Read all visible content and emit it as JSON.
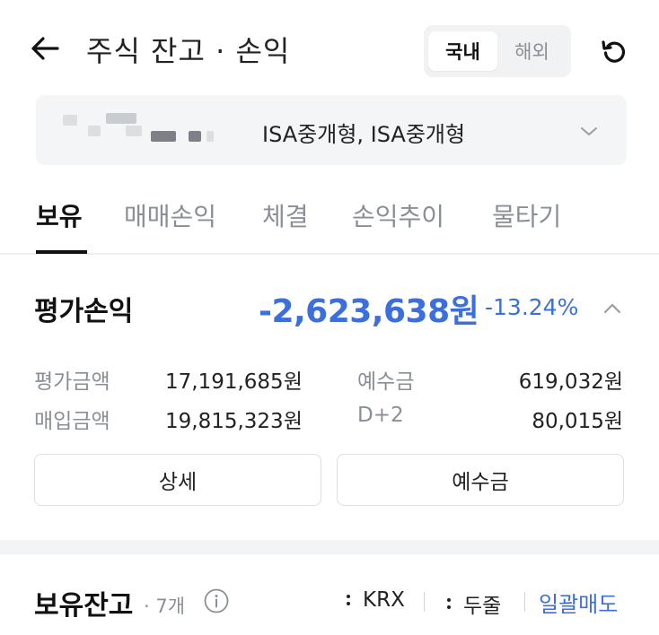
{
  "header": {
    "title": "주식 잔고 · 손익",
    "market_toggle": {
      "domestic": "국내",
      "overseas": "해외",
      "selected": "domestic"
    }
  },
  "account": {
    "name": "ISA중개형, ISA중개형"
  },
  "tabs": [
    {
      "label": "보유",
      "active": true
    },
    {
      "label": "매매손익",
      "active": false
    },
    {
      "label": "체결",
      "active": false
    },
    {
      "label": "손익추이",
      "active": false
    },
    {
      "label": "물타기",
      "active": false
    }
  ],
  "pnl": {
    "label": "평가손익",
    "value": "-2,623,638원",
    "rate": "-13.24%"
  },
  "summary": {
    "eval_amount": {
      "label": "평가금액",
      "value": "17,191,685원"
    },
    "purchase_amount": {
      "label": "매입금액",
      "value": "19,815,323원"
    },
    "deposit": {
      "label": "예수금",
      "value": "619,032원"
    },
    "d2": {
      "label": "D+2",
      "value": "80,015원"
    }
  },
  "buttons": {
    "detail": "상세",
    "deposit": "예수금"
  },
  "holdings": {
    "title": "보유잔고",
    "count": "· 7개",
    "filter_exchange": "KRX",
    "filter_unit": "두줄",
    "bulk_sell": "일괄매도"
  },
  "colors": {
    "accent_blue": "#3b6fe0",
    "text_primary": "#111111",
    "text_secondary": "#8a8f96"
  }
}
